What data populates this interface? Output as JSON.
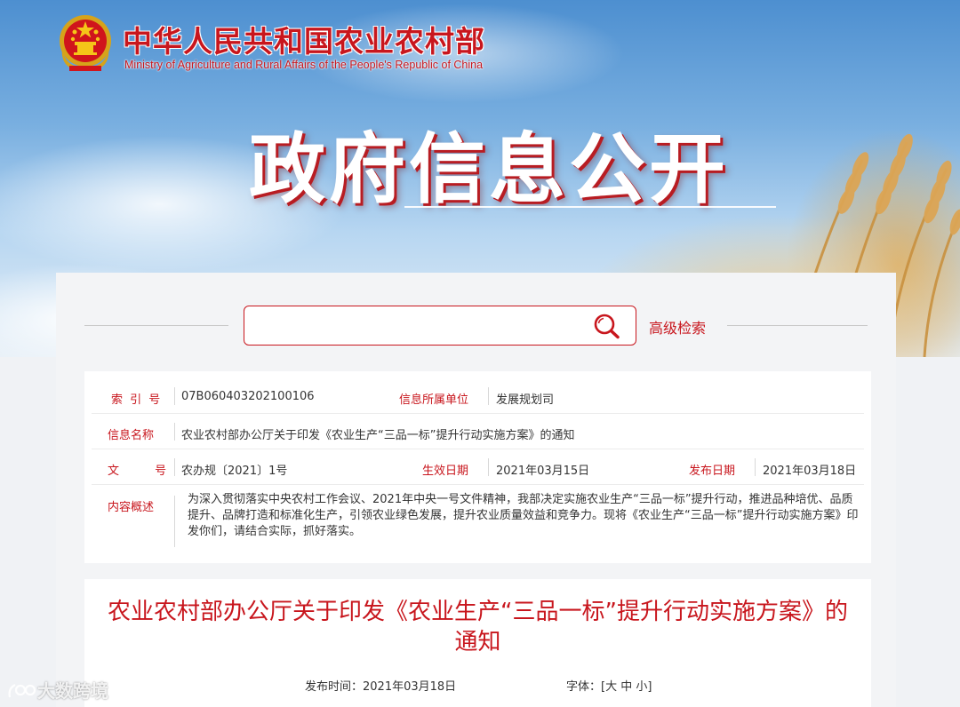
{
  "header": {
    "ministry_cn": "中华人民共和国农业农村部",
    "ministry_en": "Ministry of Agriculture and Rural Affairs of the People's Republic of China",
    "section_title": "政府信息公开"
  },
  "search": {
    "placeholder": "",
    "advanced_label": "高级检索"
  },
  "info": {
    "index_label": "索 引 号",
    "index_value": "07B060403202100106",
    "unit_label": "信息所属单位",
    "unit_value": "发展规划司",
    "name_label": "信息名称",
    "name_value": "农业农村部办公厅关于印发《农业生产“三品一标”提升行动实施方案》的通知",
    "doc_label": "文 号",
    "doc_value": "农办规〔2021〕1号",
    "effective_label": "生效日期",
    "effective_value": "2021年03月15日",
    "publish_label": "发布日期",
    "publish_value": "2021年03月18日",
    "summary_label": "内容概述",
    "summary_value": "为深入贯彻落实中央农村工作会议、2021年中央一号文件精神，我部决定实施农业生产“三品一标”提升行动，推进品种培优、品质提升、品牌打造和标准化生产，引领农业绿色发展，提升农业质量效益和竞争力。现将《农业生产“三品一标”提升行动实施方案》印发你们，请结合实际，抓好落实。"
  },
  "article": {
    "title": "农业农村部办公厅关于印发《农业生产“三品一标”提升行动实施方案》的通知",
    "date_label": "发布时间：",
    "date_value": "2021年03月18日",
    "font_label": "字体：",
    "font_open": "[",
    "font_large": "大",
    "font_medium": "中",
    "font_small": "小",
    "font_close": "]"
  },
  "watermark": "大数跨境",
  "colors": {
    "accent": "#c8161d",
    "text": "#333333",
    "panel": "#f3f4f6"
  }
}
